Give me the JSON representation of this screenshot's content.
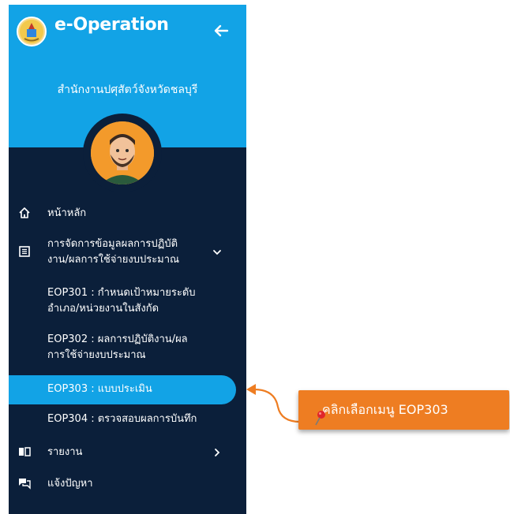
{
  "header": {
    "app_title": "e-Operation",
    "office_name": "สำนักงานปศุสัตว์จังหวัดชลบุรี"
  },
  "menu": {
    "home": "หน้าหลัก",
    "manage": {
      "line1": "การจัดการข้อมูลผลการปฏิบัติ",
      "line2": "งาน/ผลการใช้จ่ายงบประมาณ",
      "sub": [
        {
          "line1": "EOP301 : กำหนดเป้าหมายระดับ",
          "line2": "อำเภอ/หน่วยงานในสังกัด"
        },
        {
          "line1": "EOP302 : ผลการปฏิบัติงาน/ผล",
          "line2": "การใช้จ่ายงบประมาณ"
        },
        {
          "line1": "EOP303 : แบบประเมิน"
        },
        {
          "line1": "EOP304 : ตรวจสอบผลการบันทึก"
        }
      ]
    },
    "report": "รายงาน",
    "problem": "แจ้งปัญหา"
  },
  "callout": {
    "text": "คลิกเลือกเมนู EOP303"
  },
  "colors": {
    "sidebar_bg": "#0b1f3a",
    "header_bg": "#12a3e6",
    "active_bg": "#12a3e6",
    "callout_bg": "#ee7d22",
    "pin": "#e0262b"
  },
  "icons": {
    "back": "arrow-left-icon",
    "home": "home-icon",
    "manage": "table-icon",
    "report": "book-icon",
    "problem": "chat-icon"
  }
}
